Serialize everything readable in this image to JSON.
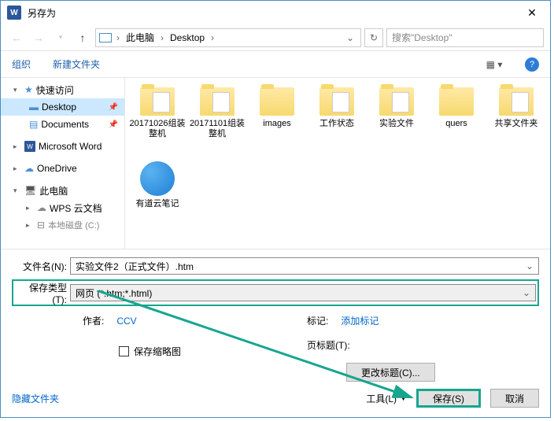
{
  "title": "另存为",
  "nav": {
    "crumb1": "此电脑",
    "crumb2": "Desktop",
    "search_placeholder": "搜索\"Desktop\""
  },
  "toolbar": {
    "organize": "组织",
    "newfolder": "新建文件夹"
  },
  "sidebar": {
    "quick": "快速访问",
    "desktop": "Desktop",
    "documents": "Documents",
    "word": "Microsoft Word",
    "onedrive": "OneDrive",
    "thispc": "此电脑",
    "wps": "WPS 云文档",
    "local": "本地磁盘 (C:)"
  },
  "items": [
    {
      "name": "20171026组装整机",
      "type": "folder-doc"
    },
    {
      "name": "20171101组装整机",
      "type": "folder-doc"
    },
    {
      "name": "images",
      "type": "folder"
    },
    {
      "name": "工作状态",
      "type": "folder-doc"
    },
    {
      "name": "实验文件",
      "type": "folder-doc"
    },
    {
      "name": "quers",
      "type": "folder"
    },
    {
      "name": "共享文件夹",
      "type": "folder-doc"
    },
    {
      "name": "有道云笔记",
      "type": "app"
    }
  ],
  "filename": {
    "label": "文件名(N):",
    "value": "实验文件2（正式文件）.htm"
  },
  "filetype": {
    "label": "保存类型(T):",
    "value": "网页 (*.htm;*.html)"
  },
  "author": {
    "label": "作者:",
    "value": "CCV"
  },
  "tags": {
    "label": "标记:",
    "value": "添加标记"
  },
  "thumb": "保存缩略图",
  "pagetitle": {
    "label": "页标题(T):",
    "value": ""
  },
  "changetitle": "更改标题(C)...",
  "tools": "工具(L)",
  "save": "保存(S)",
  "cancel": "取消",
  "hide": "隐藏文件夹"
}
